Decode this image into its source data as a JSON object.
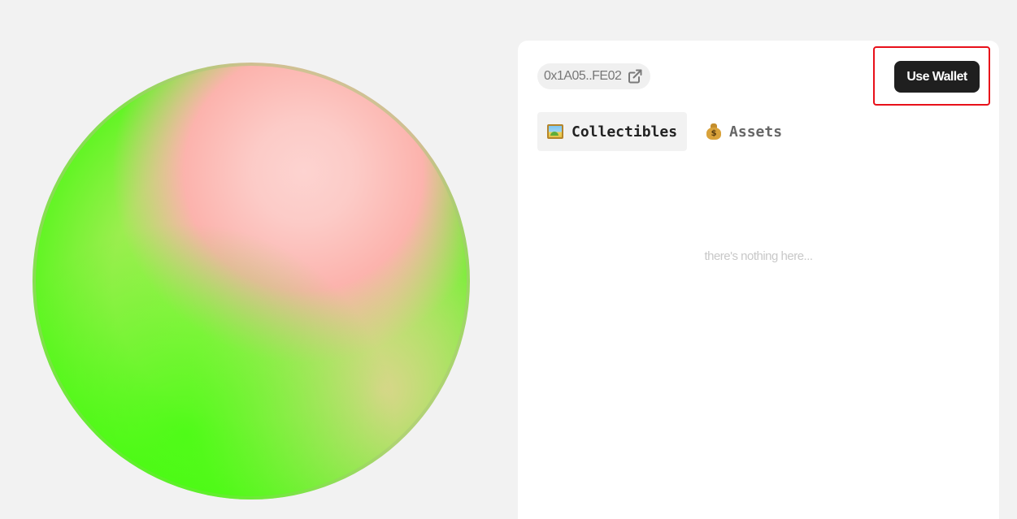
{
  "wallet": {
    "address_short": "0x1A05..FE02",
    "external_link_icon": "external-link-icon"
  },
  "header": {
    "use_wallet_label": "Use Wallet",
    "highlight_color": "#e8101a"
  },
  "tabs": [
    {
      "label": "Collectibles",
      "icon": "framed-picture-icon",
      "active": true
    },
    {
      "label": "Assets",
      "icon": "money-bag-icon",
      "active": false
    }
  ],
  "content": {
    "empty_message": "there's nothing here..."
  },
  "colors": {
    "background": "#f2f2f2",
    "panel": "#ffffff",
    "button": "#1f1f1f",
    "orb_green": "#3aff09",
    "orb_pink": "#fcb3ad"
  }
}
